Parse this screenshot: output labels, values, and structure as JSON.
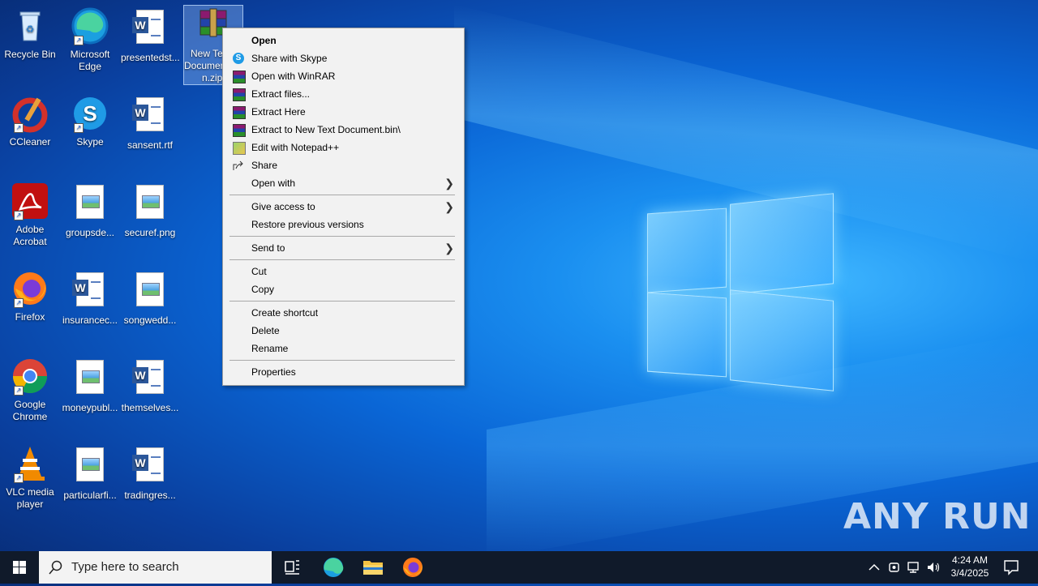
{
  "desktop": {
    "icons": [
      {
        "label": "Recycle Bin"
      },
      {
        "label": "Microsoft Edge"
      },
      {
        "label": "presentedst..."
      },
      {
        "label": "New Text Document.bin.zip"
      },
      {
        "label": "CCleaner"
      },
      {
        "label": "Skype"
      },
      {
        "label": "sansent.rtf"
      },
      {
        "label": "Adobe Acrobat"
      },
      {
        "label": "groupsde..."
      },
      {
        "label": "securef.png"
      },
      {
        "label": "Firefox"
      },
      {
        "label": "insurancec..."
      },
      {
        "label": "songwedd..."
      },
      {
        "label": "Google Chrome"
      },
      {
        "label": "moneypubl..."
      },
      {
        "label": "themselves..."
      },
      {
        "label": "VLC media player"
      },
      {
        "label": "particularfi..."
      },
      {
        "label": "tradingres..."
      }
    ],
    "selected_icon_partial_label": [
      "New Te",
      "Documen",
      "n.zip"
    ]
  },
  "context_menu": {
    "items": [
      {
        "label": "Open",
        "icon": ""
      },
      {
        "label": "Share with Skype",
        "icon": "skype-icon"
      },
      {
        "label": "Open with WinRAR",
        "icon": "winrar-icon"
      },
      {
        "label": "Extract files...",
        "icon": "winrar-icon"
      },
      {
        "label": "Extract Here",
        "icon": "winrar-icon"
      },
      {
        "label": "Extract to New Text Document.bin\\",
        "icon": "winrar-icon"
      },
      {
        "label": "Edit with Notepad++",
        "icon": "notepadpp-icon"
      },
      {
        "label": "Share",
        "icon": "share-icon"
      },
      {
        "label": "Open with",
        "submenu": true
      },
      {
        "label": "Give access to",
        "submenu": true
      },
      {
        "label": "Restore previous versions"
      },
      {
        "label": "Send to",
        "submenu": true
      },
      {
        "label": "Cut"
      },
      {
        "label": "Copy"
      },
      {
        "label": "Create shortcut"
      },
      {
        "label": "Delete"
      },
      {
        "label": "Rename"
      },
      {
        "label": "Properties"
      }
    ]
  },
  "taskbar": {
    "search_placeholder": "Type here to search",
    "time": "4:24 AM",
    "date": "3/4/2025"
  },
  "watermark": "ANY RUN",
  "colors": {
    "accent": "#0a66d6",
    "menu_bg": "#f2f2f2",
    "taskbar_bg": "#101a2a"
  }
}
